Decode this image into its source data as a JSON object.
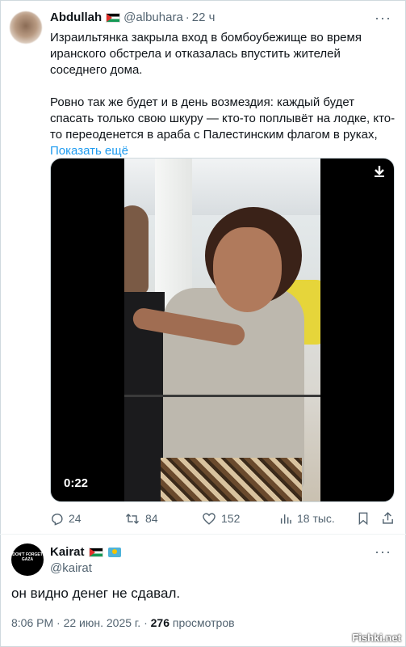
{
  "tweet": {
    "author_name": "Abdullah",
    "handle": "@albuhara",
    "separator": "·",
    "time": "22 ч",
    "more": "···",
    "paragraph1": "Израильтянка закрыла вход в бомбоубежище во время иранского обстрела и отказалась впустить жителей соседнего дома.",
    "paragraph2": "Ровно так же будет и в день возмездия: каждый будет спасать только свою шкуру — кто-то поплывёт на лодке, кто-то переоденется в араба с Палестинским флагом в руках,",
    "show_more": "Показать ещё",
    "video": {
      "duration": "0:22"
    },
    "actions": {
      "replies": "24",
      "reposts": "84",
      "likes": "152",
      "views": "18 тыс."
    }
  },
  "reply": {
    "author_name": "Kairat",
    "handle": "@kairat",
    "more": "···",
    "avatar_text": "DON'T FORGET GAZA",
    "text": "он видно денег не сдавал.",
    "time": "8:06 PM · 22 июн. 2025 г. ·",
    "views_count": "276",
    "views_label": "просмотров"
  },
  "watermark": "Fishki.net",
  "colors": {
    "link": "#1d9bf0",
    "secondary": "#536471",
    "text": "#0f1419"
  }
}
